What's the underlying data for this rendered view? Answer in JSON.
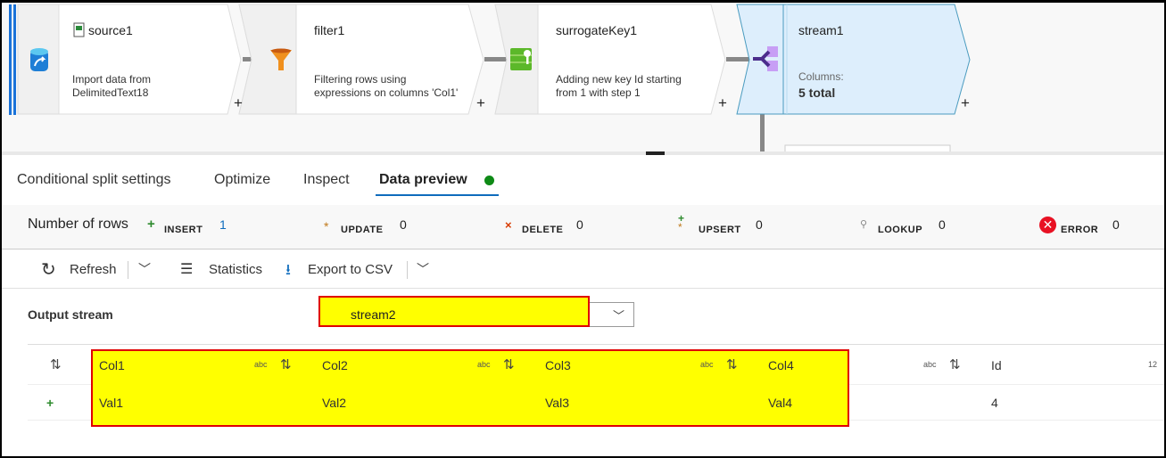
{
  "flow": {
    "nodes": [
      {
        "title": "source1",
        "desc": [
          "Import data from",
          "DelimitedText18"
        ],
        "icon": "database-source-icon"
      },
      {
        "title": "filter1",
        "desc": [
          "Filtering rows using",
          "expressions on columns 'Col1'"
        ],
        "icon": "filter-funnel-icon"
      },
      {
        "title": "surrogateKey1",
        "desc": [
          "Adding new key Id starting",
          "from 1 with step 1"
        ],
        "icon": "surrogate-key-icon"
      },
      {
        "title": "stream1",
        "desc": [
          "Columns:",
          "5 total"
        ],
        "icon": "conditional-split-icon"
      }
    ],
    "add_label": "+"
  },
  "tabs": [
    {
      "label": "Conditional split settings"
    },
    {
      "label": "Optimize"
    },
    {
      "label": "Inspect"
    },
    {
      "label": "Data preview",
      "active": true,
      "status_color": "#0e8a16"
    }
  ],
  "counts": {
    "label": "Number of rows",
    "items": [
      {
        "label": "INSERT",
        "value": "1",
        "icon": "plus-icon",
        "color": "#2e8b2e"
      },
      {
        "label": "UPDATE",
        "value": "0",
        "icon": "asterisk-icon",
        "color": "#c07a1c"
      },
      {
        "label": "DELETE",
        "value": "0",
        "icon": "x-icon",
        "color": "#d83b01"
      },
      {
        "label": "UPSERT",
        "value": "0",
        "icon": "upsert-icon",
        "color": "#2e8b2e"
      },
      {
        "label": "LOOKUP",
        "value": "0",
        "icon": "search-icon",
        "color": "#888"
      },
      {
        "label": "ERROR",
        "value": "0",
        "icon": "error-icon",
        "color": "#e81123"
      }
    ]
  },
  "toolbar": {
    "refresh": "Refresh",
    "statistics": "Statistics",
    "export": "Export to CSV"
  },
  "output_stream": {
    "label": "Output stream",
    "value": "stream2"
  },
  "table": {
    "columns": [
      {
        "name": "Col1",
        "type": "abc"
      },
      {
        "name": "Col2",
        "type": "abc"
      },
      {
        "name": "Col3",
        "type": "abc"
      },
      {
        "name": "Col4",
        "type": "abc"
      },
      {
        "name": "Id",
        "type": "12"
      }
    ],
    "rows": [
      {
        "marker": "+",
        "values": [
          "Val1",
          "Val2",
          "Val3",
          "Val4",
          "4"
        ]
      }
    ]
  },
  "highlight_color": "#ffff00"
}
